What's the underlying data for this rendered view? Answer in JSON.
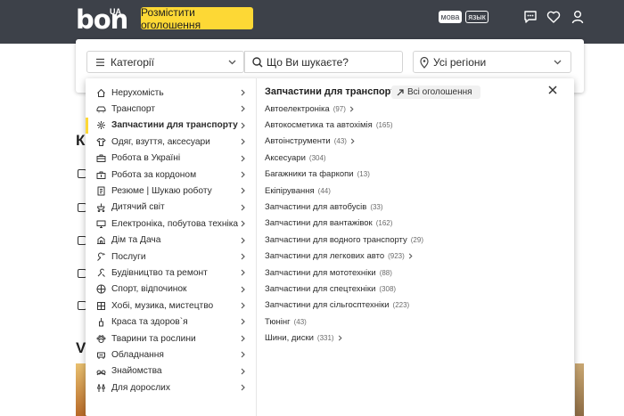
{
  "header": {
    "logo": "bon",
    "logo_suffix": "UA",
    "post_button": "Розмістити оголошення",
    "lang_ua": "мова",
    "lang_ru": "язык",
    "icons": [
      "chat-icon",
      "heart-icon",
      "user-icon"
    ],
    "colors": {
      "bar": "#3d4149",
      "accent": "#fdd835"
    }
  },
  "search": {
    "category_label": "Категорії",
    "query_placeholder": "Що Ви шукаєте?",
    "region_label": "Усі регіони"
  },
  "page_background": {
    "heading_fragment_1": "Ка",
    "heading_fragment_2": "VI"
  },
  "dropdown": {
    "categories": [
      {
        "label": "Нерухомість",
        "icon": "house-icon"
      },
      {
        "label": "Транспорт",
        "icon": "car-icon"
      },
      {
        "label": "Запчастини для транспорту",
        "icon": "gear-icon",
        "active": true
      },
      {
        "label": "Одяг, взуття, аксесуари",
        "icon": "shirt-icon"
      },
      {
        "label": "Робота в Україні",
        "icon": "briefcase-icon"
      },
      {
        "label": "Робота за кордоном",
        "icon": "briefcase-globe-icon"
      },
      {
        "label": "Резюме | Шукаю роботу",
        "icon": "resume-icon"
      },
      {
        "label": "Дитячий світ",
        "icon": "stroller-icon"
      },
      {
        "label": "Електроніка, побутова техніка",
        "icon": "monitor-icon"
      },
      {
        "label": "Дім та Дача",
        "icon": "home-garden-icon"
      },
      {
        "label": "Послуги",
        "icon": "service-icon"
      },
      {
        "label": "Будівництво та ремонт",
        "icon": "tools-icon"
      },
      {
        "label": "Спорт, відпочинок",
        "icon": "ball-icon"
      },
      {
        "label": "Хобі, музика, мистецтво",
        "icon": "hobby-icon"
      },
      {
        "label": "Краса та здоров`я",
        "icon": "beauty-icon"
      },
      {
        "label": "Тварини та рослини",
        "icon": "paw-icon"
      },
      {
        "label": "Обладнання",
        "icon": "equipment-icon"
      },
      {
        "label": "Знайомства",
        "icon": "dating-icon"
      },
      {
        "label": "Для дорослих",
        "icon": "adult-icon"
      }
    ],
    "sub_title": "Запчастини для транспорту",
    "all_ads": "Всі оголошення",
    "subcategories": [
      {
        "label": "Автоелектроніка",
        "count": "(97)",
        "has_children": true
      },
      {
        "label": "Автокосметика та автохімія",
        "count": "(165)",
        "has_children": false
      },
      {
        "label": "Автоінструменти",
        "count": "(43)",
        "has_children": true
      },
      {
        "label": "Аксесуари",
        "count": "(304)",
        "has_children": false
      },
      {
        "label": "Багажники та фаркопи",
        "count": "(13)",
        "has_children": false
      },
      {
        "label": "Екіпірування",
        "count": "(44)",
        "has_children": false
      },
      {
        "label": "Запчастини для автобусів",
        "count": "(33)",
        "has_children": false
      },
      {
        "label": "Запчастини для вантажівок",
        "count": "(162)",
        "has_children": false
      },
      {
        "label": "Запчастини для водного транспорту",
        "count": "(29)",
        "has_children": false
      },
      {
        "label": "Запчастини для легкових авто",
        "count": "(923)",
        "has_children": true
      },
      {
        "label": "Запчастини для мототехніки",
        "count": "(88)",
        "has_children": false
      },
      {
        "label": "Запчастини для спецтехніки",
        "count": "(308)",
        "has_children": false
      },
      {
        "label": "Запчастини для сільгосптехніки",
        "count": "(223)",
        "has_children": false
      },
      {
        "label": "Тюнінг",
        "count": "(43)",
        "has_children": false
      },
      {
        "label": "Шини, диски",
        "count": "(331)",
        "has_children": true
      }
    ]
  }
}
